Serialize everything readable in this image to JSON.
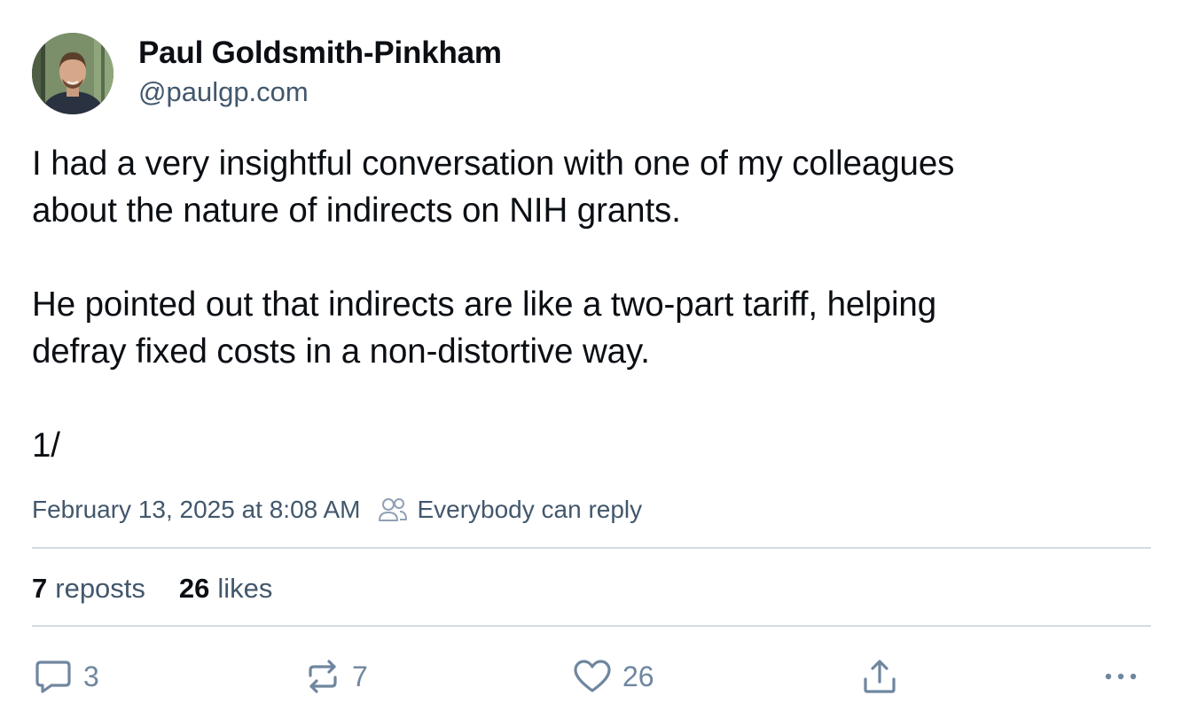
{
  "author": {
    "display_name": "Paul Goldsmith-Pinkham",
    "handle": "@paulgp.com",
    "avatar_icon": "avatar-photo"
  },
  "post": {
    "text": "I had a very insightful conversation with one of my colleagues\nabout the nature of indirects on NIH grants.\n\nHe pointed out that indirects are like a two-part tariff, helping\ndefray fixed costs in a non-distortive way.\n\n1/"
  },
  "meta": {
    "timestamp": "February 13, 2025 at 8:08 AM",
    "reply_scope": "Everybody can reply",
    "reply_scope_icon": "people-icon"
  },
  "stats": {
    "reposts_count": "7",
    "reposts_label": "reposts",
    "likes_count": "26",
    "likes_label": "likes"
  },
  "actions": {
    "reply_count": "3",
    "repost_count": "7",
    "like_count": "26",
    "reply_icon": "speech-bubble-icon",
    "repost_icon": "repost-arrows-icon",
    "like_icon": "heart-icon",
    "share_icon": "share-icon",
    "more_icon": "ellipsis-icon"
  },
  "colors": {
    "text_primary": "#0b0f14",
    "text_secondary": "#42576c",
    "icon": "#6f869f",
    "divider": "#d4dbe2"
  }
}
